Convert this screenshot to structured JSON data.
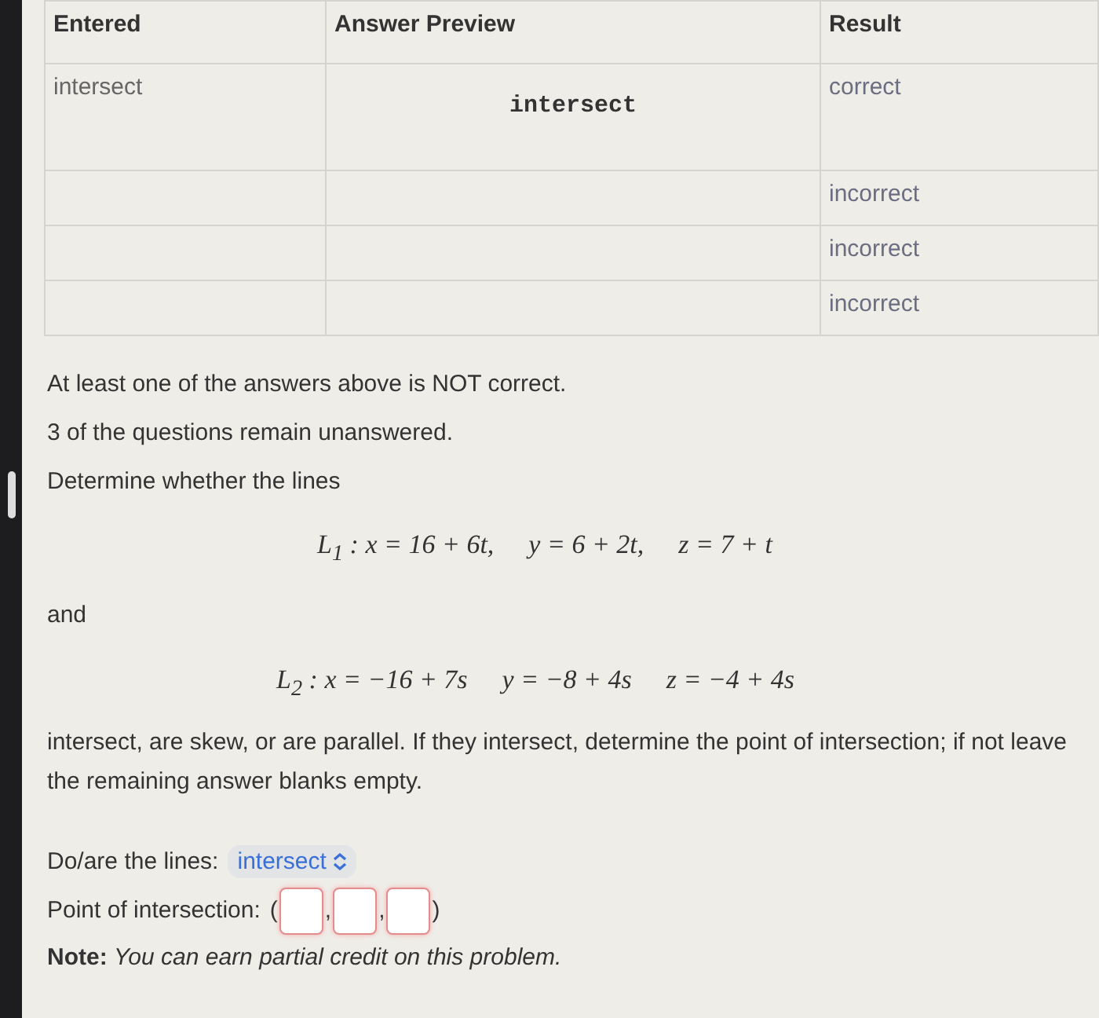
{
  "results_table": {
    "columns": [
      "Entered",
      "Answer Preview",
      "Result"
    ],
    "rows": [
      {
        "entered": "intersect",
        "preview": "intersect",
        "result": "correct"
      },
      {
        "result": "incorrect"
      },
      {
        "result": "incorrect"
      },
      {
        "result": "incorrect"
      }
    ]
  },
  "messages": [
    "At least one of the answers above is NOT correct.",
    "3 of the questions remain unanswered."
  ],
  "problem": {
    "intro": "Determine whether the lines",
    "line_1": [
      "L$_{1}$ : x = 16 + 6t,",
      "y = 6 + 2t,",
      "z = 7 + t"
    ],
    "connector": "and",
    "line_2": [
      "L$_{2}$ : x = −16 + 7s",
      "y = −8 + 4s",
      "z = −4 + 4s"
    ],
    "question": "intersect, are skew, or are parallel. If they intersect, determine the point of intersection; if not leave the remaining answer blanks empty."
  },
  "answers": {
    "select_label": "Do/are the lines:",
    "select_value": "intersect",
    "point_label": "Point of intersection:",
    "open": "(",
    "separator": ",",
    "close": ")",
    "blanks": [
      {
        "incorrect": true
      },
      {
        "incorrect": true
      },
      {
        "incorrect": true
      }
    ],
    "note": "**Note:** *You can earn partial credit on this problem.*"
  }
}
